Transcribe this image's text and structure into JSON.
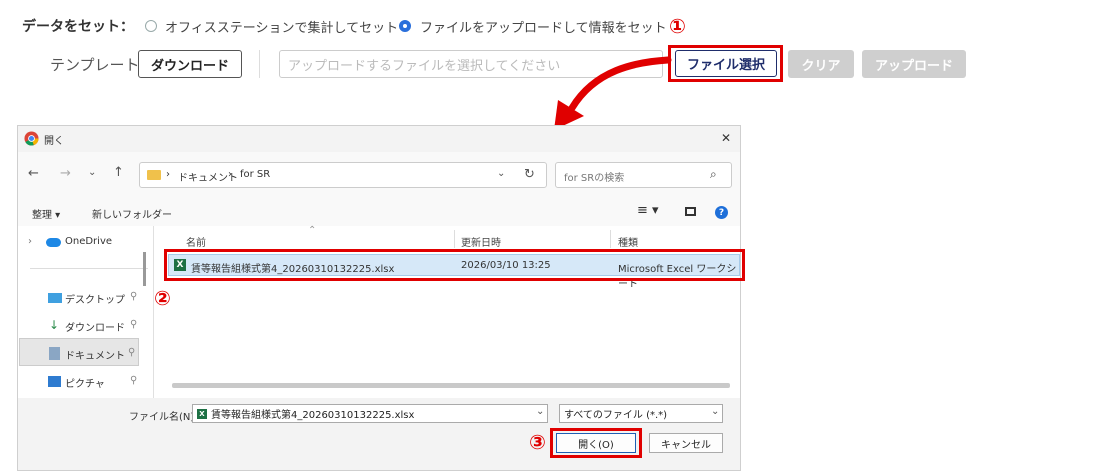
{
  "top": {
    "data_label": "データをセット：",
    "radio1_label": "オフィスステーションで集計してセット",
    "radio2_label": "ファイルをアップロードして情報をセット",
    "template_label": "テンプレート：",
    "download_button": "ダウンロード",
    "file_placeholder": "アップロードするファイルを選択してください",
    "select_file_button": "ファイル選択",
    "clear_button": "クリア",
    "upload_button": "アップロード"
  },
  "annotations": {
    "step1": "①",
    "step2": "②",
    "step3": "③"
  },
  "dialog": {
    "title": "開く",
    "close": "✕",
    "breadcrumb": {
      "sep": "›",
      "part1": "ドキュメント",
      "part2": "for SR"
    },
    "search_placeholder": "for SRの検索",
    "organize": "整理 ▾",
    "new_folder": "新しいフォルダー",
    "nav": {
      "onedrive": "OneDrive",
      "desktop": "デスクトップ",
      "downloads": "ダウンロード",
      "documents": "ドキュメント",
      "pictures": "ピクチャ"
    },
    "columns": {
      "name": "名前",
      "date": "更新日時",
      "type": "種類"
    },
    "file": {
      "name": "賃等報告組様式第4_20260310132225.xlsx",
      "date": "2026/03/10 13:25",
      "type": "Microsoft Excel ワークシート"
    },
    "filename_label": "ファイル名(N):",
    "filename_value": "賃等報告組様式第4_20260310132225.xlsx",
    "filetype_value": "すべてのファイル (*.*)",
    "open_button": "開く(O)",
    "cancel_button": "キャンセル"
  },
  "colors": {
    "accent_red": "#e00000",
    "radio_blue": "#2a6fdb",
    "navy": "#1f2d6b"
  }
}
